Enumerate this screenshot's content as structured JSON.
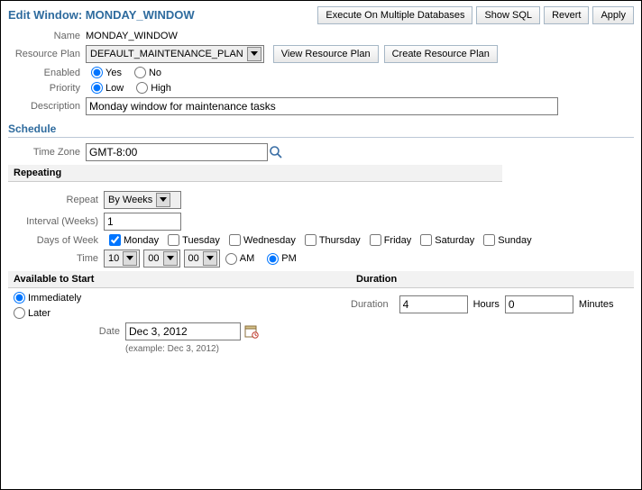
{
  "header": {
    "title": "Edit Window: MONDAY_WINDOW",
    "buttons": [
      "Execute On Multiple Databases",
      "Show SQL",
      "Revert",
      "Apply"
    ]
  },
  "form": {
    "name": {
      "label": "Name",
      "value": "MONDAY_WINDOW"
    },
    "resource_plan": {
      "label": "Resource Plan",
      "value": "DEFAULT_MAINTENANCE_PLAN",
      "buttons": [
        "View Resource Plan",
        "Create Resource Plan"
      ]
    },
    "enabled": {
      "label": "Enabled",
      "options": [
        "Yes",
        "No"
      ],
      "selected": "Yes"
    },
    "priority": {
      "label": "Priority",
      "options": [
        "Low",
        "High"
      ],
      "selected": "Low"
    },
    "description": {
      "label": "Description",
      "value": "Monday window for maintenance tasks"
    }
  },
  "schedule": {
    "title": "Schedule",
    "timezone": {
      "label": "Time Zone",
      "value": "GMT-8:00"
    },
    "repeating": {
      "title": "Repeating",
      "repeat": {
        "label": "Repeat",
        "value": "By Weeks"
      },
      "interval": {
        "label": "Interval (Weeks)",
        "value": "1"
      },
      "days": {
        "label": "Days of Week",
        "options": [
          "Monday",
          "Tuesday",
          "Wednesday",
          "Thursday",
          "Friday",
          "Saturday",
          "Sunday"
        ],
        "checked": [
          "Monday"
        ]
      },
      "time": {
        "label": "Time",
        "hour": "10",
        "minute": "00",
        "second": "00",
        "ampm": [
          "AM",
          "PM"
        ],
        "selected": "PM"
      }
    }
  },
  "available": {
    "title": "Available to Start",
    "options": [
      "Immediately",
      "Later"
    ],
    "selected": "Immediately",
    "date": {
      "label": "Date",
      "value": "Dec 3, 2012",
      "example": "(example: Dec 3, 2012)"
    }
  },
  "duration": {
    "title": "Duration",
    "label": "Duration",
    "hours": "4",
    "hours_label": "Hours",
    "minutes": "0",
    "minutes_label": "Minutes"
  }
}
